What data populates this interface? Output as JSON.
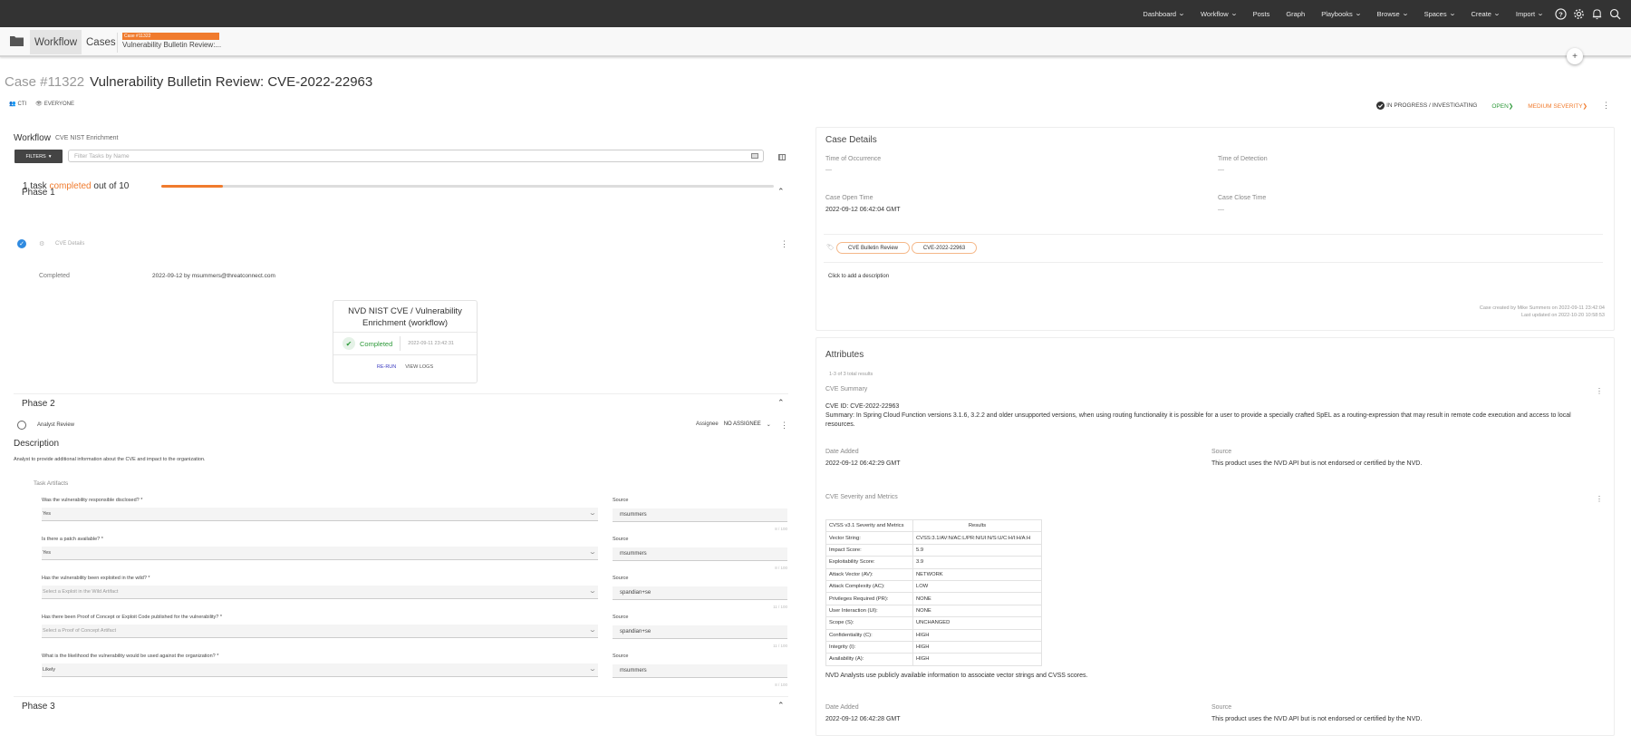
{
  "topnav": {
    "items": [
      {
        "label": "Dashboard",
        "dropdown": true
      },
      {
        "label": "Workflow",
        "dropdown": true
      },
      {
        "label": "Posts",
        "dropdown": false
      },
      {
        "label": "Graph",
        "dropdown": false
      },
      {
        "label": "Playbooks",
        "dropdown": true
      },
      {
        "label": "Browse",
        "dropdown": true
      },
      {
        "label": "Spaces",
        "dropdown": true
      },
      {
        "label": "Create",
        "dropdown": true
      },
      {
        "label": "Import",
        "dropdown": true
      }
    ],
    "icons": [
      "help-icon",
      "settings-icon",
      "notifications-icon",
      "search-icon"
    ]
  },
  "subbar": {
    "breadcrumbs": [
      "Workflow",
      "Cases"
    ],
    "case_tab": {
      "tag": "Case #11322",
      "title": "Vulnerability Bulletin Review:..."
    },
    "add_symbol": "+"
  },
  "header": {
    "case_number": "Case #11322",
    "title": "Vulnerability Bulletin Review: CVE-2022-22963",
    "owner": "CTI",
    "visibility": "EVERYONE",
    "status": "IN PROGRESS / INVESTIGATING",
    "resolution": "OPEN",
    "severity": "MEDIUM SEVERITY",
    "colors": {
      "accent": "#f07b2d",
      "open": "#2e9a3a",
      "check": "#2f8ae0"
    }
  },
  "workflow": {
    "label": "Workflow",
    "name": "CVE NIST Enrichment",
    "filters_label": "FILTERS",
    "filter_placeholder": "Filter Tasks by Name",
    "progress": {
      "prefix": "1 task",
      "highlight": "completed",
      "suffix": "out of 10",
      "completed": 1,
      "total": 10
    },
    "phases": [
      {
        "title": "Phase 1",
        "task": {
          "name": "CVE Details",
          "completed_label": "Completed",
          "completed_by": "2022-09-12 by msummers@threatconnect.com",
          "card": {
            "title": "NVD NIST CVE / Vulnerability Enrichment (workflow)",
            "status": "Completed",
            "date": "2022-09-11 23:42:31",
            "rerun": "RE-RUN",
            "view_logs": "VIEW LOGS"
          }
        }
      },
      {
        "title": "Phase 2",
        "task": {
          "name": "Analyst Review",
          "assignee_label": "Assignee",
          "assignee_value": "NO ASSIGNEE",
          "description_heading": "Description",
          "description": "Analyst to provide additional information about the CVE and impact to the organization.",
          "artifacts_heading": "Task Artifacts",
          "artifacts": [
            {
              "question": "Was the vulnerability responsible disclosed? *",
              "value": "Yes",
              "placeholder": false,
              "source_label": "Source",
              "source": "msummers",
              "count": "8 / 100"
            },
            {
              "question": "Is there a patch available? *",
              "value": "Yes",
              "placeholder": false,
              "source_label": "Source",
              "source": "msummers",
              "count": "8 / 100"
            },
            {
              "question": "Has the vulnerability been exploited in the wild? *",
              "value": "Select a Exploit in the Wild Artifact",
              "placeholder": true,
              "source_label": "Source",
              "source": "spandian+se",
              "count": "11 / 100"
            },
            {
              "question": "Has there been Proof of Concept or Exploit Code published for the vulnerability? *",
              "value": "Select a Proof of Concept Artifact",
              "placeholder": true,
              "source_label": "Source",
              "source": "spandian+se",
              "count": "11 / 100"
            },
            {
              "question": "What is the likelihood the vulnerability would be used against the organization? *",
              "value": "Likely",
              "placeholder": false,
              "source_label": "Source",
              "source": "msummers",
              "count": "8 / 100"
            }
          ]
        }
      },
      {
        "title": "Phase 3"
      }
    ]
  },
  "case_details": {
    "title": "Case Details",
    "fields": [
      {
        "label": "Time of Occurrence",
        "value": "—"
      },
      {
        "label": "Time of Detection",
        "value": "—"
      },
      {
        "label": "Case Open Time",
        "value": "2022-09-12 06:42:04 GMT"
      },
      {
        "label": "Case Close Time",
        "value": "—"
      }
    ],
    "tags": [
      "CVE Bulletin Review",
      "CVE-2022-22963"
    ],
    "description_placeholder": "Click to add a description",
    "created": "Case created by Mike Summers on 2022-09-11 23:42:04",
    "updated": "Last updated on 2022-10-20 10:58:53"
  },
  "attributes": {
    "title": "Attributes",
    "count": "1-3 of 3 total results",
    "items": [
      {
        "type": "CVE Summary",
        "cve_id": "CVE ID: CVE-2022-22963",
        "summary": "Summary: In Spring Cloud Function versions 3.1.6, 3.2.2 and older unsupported versions, when using routing functionality it is possible for a user to provide a specially crafted SpEL as a routing-expression that may result in remote code execution and access to local resources.",
        "date_label": "Date Added",
        "date": "2022-09-12 06:42:29 GMT",
        "source_label": "Source",
        "source": "This product uses the NVD API but is not endorsed or certified by the NVD."
      },
      {
        "type": "CVE Severity and Metrics",
        "table_headers": [
          "CVSS v3.1 Severity and Metrics",
          "Results"
        ],
        "table_rows": [
          [
            "Vector String:",
            "CVSS:3.1/AV:N/AC:L/PR:N/UI:N/S:U/C:H/I:H/A:H"
          ],
          [
            "Impact Score:",
            "5.9"
          ],
          [
            "Exploitability Score:",
            "3.9"
          ],
          [
            "Attack Vector (AV):",
            "NETWORK"
          ],
          [
            "Attack Complexity (AC):",
            "LOW"
          ],
          [
            "Privileges Required (PR):",
            "NONE"
          ],
          [
            "User Interaction (UI):",
            "NONE"
          ],
          [
            "Scope (S):",
            "UNCHANGED"
          ],
          [
            "Confidentiality (C):",
            "HIGH"
          ],
          [
            "Integrity (I):",
            "HIGH"
          ],
          [
            "Availability (A):",
            "HIGH"
          ]
        ],
        "note": "NVD Analysts use publicly available information to associate vector strings and CVSS scores.",
        "date_label": "Date Added",
        "date": "2022-09-12 06:42:28 GMT",
        "source_label": "Source",
        "source": "This product uses the NVD API but is not endorsed or certified by the NVD."
      }
    ]
  }
}
